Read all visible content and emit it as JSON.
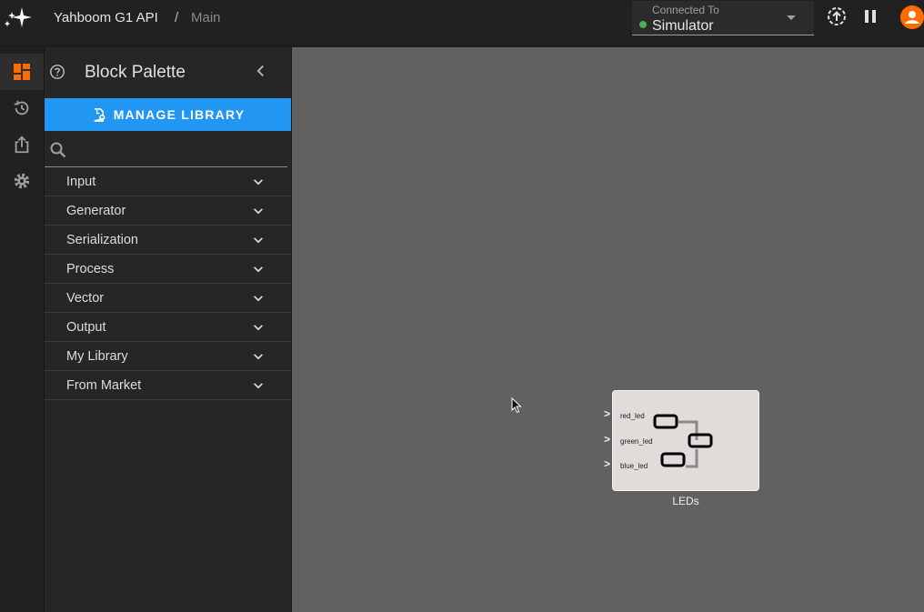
{
  "app": {
    "name": "Yahboom G1 API",
    "separator": "/",
    "page": "Main"
  },
  "connection": {
    "label": "Connected To",
    "value": "Simulator",
    "status_color": "#4caf50"
  },
  "toolbar": {
    "icons": [
      "upload-sync-icon",
      "pause-icon",
      "account-icon"
    ]
  },
  "rail": {
    "items": [
      {
        "name": "dashboard-icon",
        "active": true
      },
      {
        "name": "history-icon",
        "active": false
      },
      {
        "name": "export-icon",
        "active": false
      },
      {
        "name": "settings-icon",
        "active": false
      }
    ]
  },
  "palette": {
    "title": "Block Palette",
    "manage_label": "MANAGE LIBRARY",
    "search_placeholder": "",
    "categories": [
      {
        "label": "Input"
      },
      {
        "label": "Generator"
      },
      {
        "label": "Serialization"
      },
      {
        "label": "Process"
      },
      {
        "label": "Vector"
      },
      {
        "label": "Output"
      },
      {
        "label": "My Library"
      },
      {
        "label": "From Market"
      }
    ]
  },
  "block": {
    "name": "LEDs",
    "ports": [
      "red_led",
      "green_led",
      "blue_led"
    ]
  },
  "colors": {
    "accent": "#2196f3",
    "brand": "#ff6d00",
    "canvas": "#616161"
  }
}
